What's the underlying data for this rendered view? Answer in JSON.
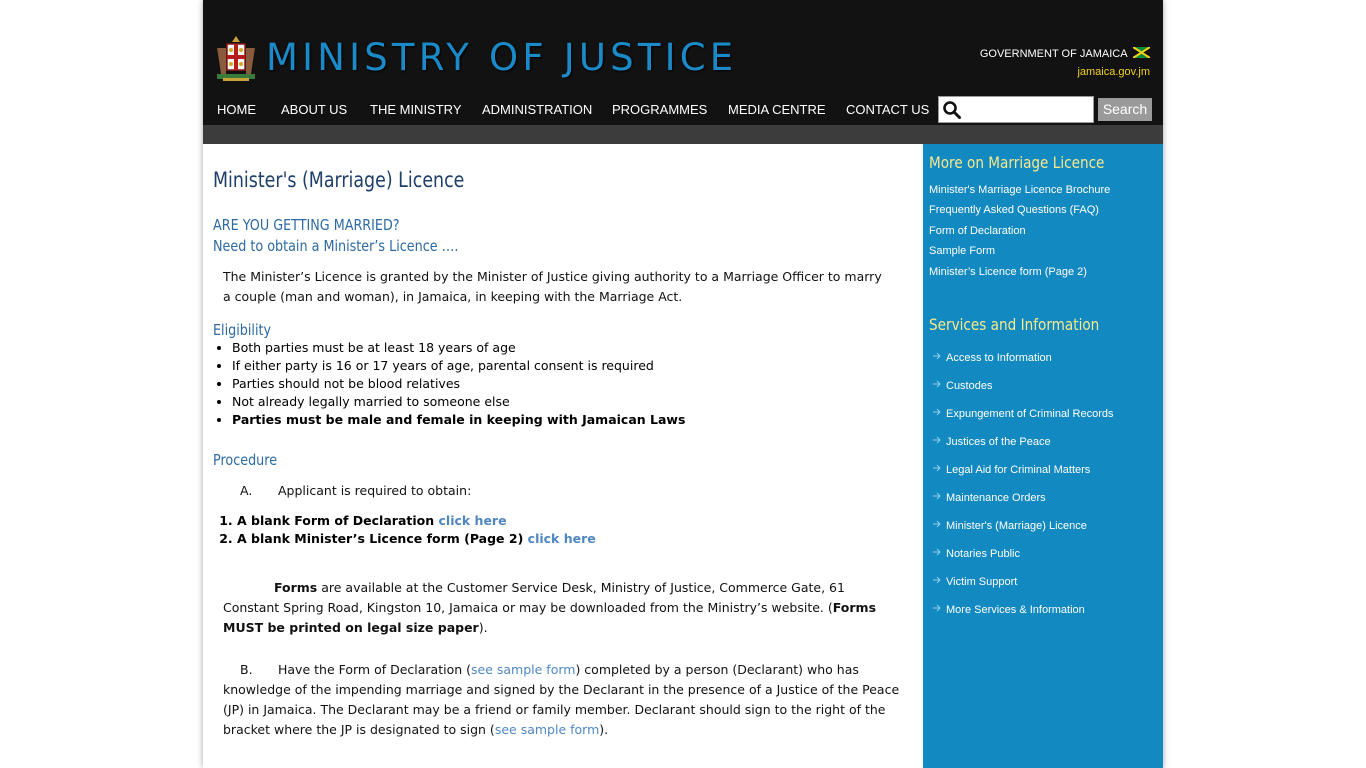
{
  "header": {
    "title": "MINISTRY OF JUSTICE",
    "gov_label": "GOVERNMENT OF JAMAICA",
    "gov_link": "jamaica.gov.jm"
  },
  "nav": {
    "items": [
      "HOME",
      "ABOUT US",
      "THE MINISTRY",
      "ADMINISTRATION",
      "PROGRAMMES",
      "MEDIA CENTRE",
      "CONTACT US"
    ],
    "search_value": "",
    "search_button": "Search"
  },
  "main": {
    "title": "Minister's (Marriage) Licence",
    "intro_heading_1": "ARE YOU GETTING MARRIED?",
    "intro_heading_2": "Need to obtain a Minister’s Licence ….",
    "intro_text": "The Minister’s Licence is granted by the Minister of Justice giving authority to a Marriage Officer to marry a couple (man and woman), in Jamaica, in keeping with the Marriage Act.",
    "eligibility_heading": "Eligibility",
    "eligibility": [
      "Both parties must be at least 18 years of age",
      "If either party is 16 or 17 years of age, parental consent is required",
      "Parties should not be blood relatives",
      "Not already legally married to someone else",
      "Parties must be male and female in keeping with Jamaican Laws"
    ],
    "procedure_heading": "Procedure",
    "step_a_label": "A.",
    "step_a_text": "Applicant is required to obtain:",
    "forms": [
      {
        "text": "A blank Form of Declaration",
        "link": "click here"
      },
      {
        "text": "A blank Minister’s Licence form (Page 2)",
        "link": "click here"
      }
    ],
    "forms_para": {
      "bold_start": "Forms",
      "text": " are available at the Customer Service Desk, Ministry of Justice, Commerce Gate, 61 Constant Spring Road, Kingston 10, Jamaica or may be downloaded from the Ministry’s website.  (",
      "bold_end": "Forms MUST be printed on legal size paper",
      "close": ")."
    },
    "step_b": {
      "label": "B.",
      "text1": "Have the Form of Declaration (",
      "link1": "see sample form",
      "text2": ") completed by a person (Declarant) who has knowledge of the impending marriage and signed by the Declarant in the presence of a Justice of the Peace (JP) in Jamaica. The Declarant may be a friend or family member. Declarant should sign to the right of the bracket where the JP is designated to sign (",
      "link2": "see sample form",
      "text3": ")."
    }
  },
  "sidebar": {
    "more_heading": "More on Marriage Licence",
    "more_links": [
      "Minister's Marriage Licence Brochure",
      "Frequently Asked Questions (FAQ)",
      "Form of Declaration",
      "Sample Form",
      "Minister’s Licence form (Page 2)"
    ],
    "services_heading": "Services and Information",
    "services": [
      "Access to Information",
      "Custodes",
      "Expungement of Criminal Records",
      "Justices of the Peace",
      "Legal Aid for Criminal Matters",
      "Maintenance Orders",
      "Minister's (Marriage) Licence",
      "Notaries Public",
      "Victim Support",
      "More Services & Information"
    ]
  },
  "colors": {
    "title_blue": "#1a8bc8",
    "sidebar_blue": "#1289c0",
    "sidebar_heading": "#f7e98e",
    "link_blue": "#4f87c2",
    "heading_blue": "#2d6aa3"
  }
}
